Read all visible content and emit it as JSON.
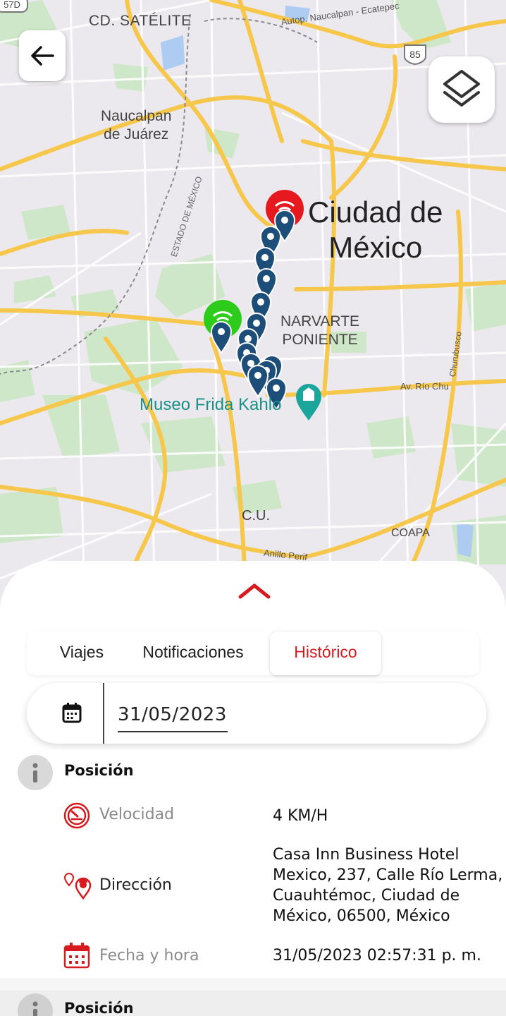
{
  "map": {
    "labels": {
      "satelite": "CD. SATÉLITE",
      "naucalpan": "Naucalpan\nde Juárez",
      "cdmx": "Ciudad de\nMéxico",
      "narvarte": "NARVARTE\nPONIENTE",
      "frida": "Museo Frida Kahlo",
      "cu": "C.U.",
      "coapa": "COAPA",
      "naucalpan_ecatepec": "Autop. Naucalpan - Ecatepec",
      "estado_mexico": "ESTADO DE MÉXICO",
      "rio_churubusco": "Av. Río Chu",
      "churubusco_vertical": "Churubusco",
      "anillo": "Anillo Perif",
      "highway_85": "85",
      "highway_57d": "57D"
    },
    "icons": {
      "back": "arrow-left-icon",
      "layers": "layers-icon",
      "start_marker": "green-signal-marker",
      "end_marker": "red-signal-marker",
      "track_pin": "blue-location-pin",
      "museum_pin": "museum-pin"
    },
    "colors": {
      "track": "#1d4e7a",
      "start": "#2ecc1a",
      "end": "#e5191e",
      "roads": "#f7c948",
      "parks": "#cde8c8",
      "water": "#a8c8f0"
    }
  },
  "sheet": {
    "tabs": [
      {
        "label": "Viajes",
        "active": false
      },
      {
        "label": "Notificaciones",
        "active": false
      },
      {
        "label": "Histórico",
        "active": true
      }
    ],
    "date_value": "31/05/2023"
  },
  "record": {
    "title": "Posición",
    "rows": [
      {
        "icon": "speedometer-icon",
        "label": "Velocidad",
        "value": "4 KM/H"
      },
      {
        "icon": "location-pin-icon",
        "label": "Dirección",
        "value": "Casa Inn Business Hotel Mexico, 237, Calle Río Lerma, Cuauhtémoc, Ciudad de México, 06500, México"
      },
      {
        "icon": "calendar-icon",
        "label": "Fecha y hora",
        "value": "31/05/2023 02:57:31 p. m."
      }
    ]
  },
  "next_record": {
    "title": "Posición"
  },
  "accent_color": "#d71920"
}
